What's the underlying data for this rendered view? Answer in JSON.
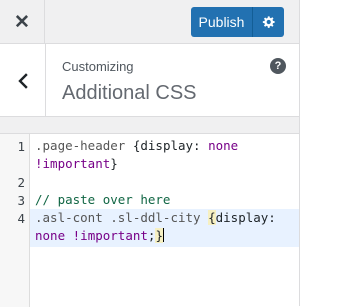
{
  "topbar": {
    "close_glyph": "✕",
    "publish_label": "Publish",
    "settings_icon": "gear-icon"
  },
  "section": {
    "customizing_label": "Customizing",
    "title": "Additional CSS",
    "help_glyph": "?"
  },
  "editor": {
    "line_numbers": [
      "1",
      "2",
      "3",
      "4"
    ],
    "line1a": {
      "selector": ".page-header ",
      "brace_open": "{",
      "property": "display: ",
      "value": "none"
    },
    "line1b": {
      "important": "!important",
      "brace_close": "}"
    },
    "line3": {
      "comment": "// paste over here"
    },
    "line4a": {
      "selector": ".asl-cont .sl-ddl-city ",
      "brace_open": "{",
      "property": "display:"
    },
    "line4b": {
      "value": "none ",
      "important": "!important",
      "semicolon": ";",
      "brace_close": "}"
    }
  },
  "colors": {
    "publish_bg": "#2271b1",
    "panel_bg": "#f0f0f1",
    "active_line": "#e8f2ff",
    "comment": "#116644",
    "keyword": "#770088"
  }
}
